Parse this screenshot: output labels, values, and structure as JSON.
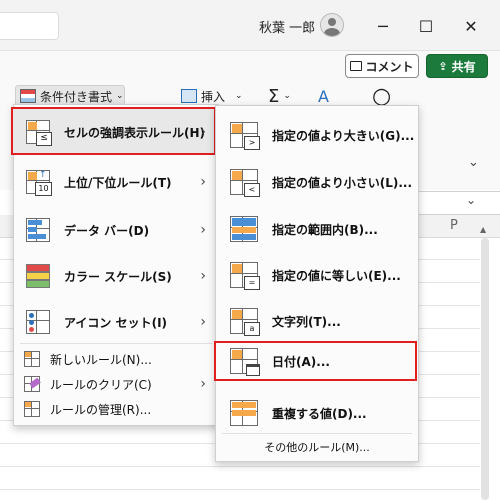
{
  "titlebar": {
    "user_name": "秋葉 一郎",
    "minimize": "─",
    "maximize": "☐",
    "close": "✕"
  },
  "ribbon": {
    "comment_label": "コメント",
    "share_label": "共有",
    "cf_label": "条件付き書式",
    "insert_label": "挿入",
    "sum_symbol": "Σ",
    "sort_symbol": "A",
    "find_symbol": "○"
  },
  "sheet": {
    "col_p": "P"
  },
  "menu": {
    "items": [
      {
        "label": "セルの強調表示ルール(H)",
        "underline": "H",
        "icon": "highlight-cells-rules-icon",
        "highlighted": true
      },
      {
        "label": "上位/下位ルール(T)",
        "underline": "T",
        "icon": "top-bottom-rules-icon"
      },
      {
        "label": "データ バー(D)",
        "underline": "D",
        "icon": "data-bars-icon"
      },
      {
        "label": "カラー スケール(S)",
        "underline": "S",
        "icon": "color-scales-icon"
      },
      {
        "label": "アイコン セット(I)",
        "underline": "I",
        "icon": "icon-sets-icon"
      }
    ],
    "small_items": [
      {
        "label": "新しいルール(N)...",
        "icon": "new-rule-icon"
      },
      {
        "label": "ルールのクリア(C)",
        "icon": "clear-rules-icon"
      },
      {
        "label": "ルールの管理(R)...",
        "icon": "manage-rules-icon"
      }
    ]
  },
  "submenu": {
    "items": [
      {
        "label": "指定の値より大きい(G)...",
        "icon": "greater-than-icon",
        "badge": ">"
      },
      {
        "label": "指定の値より小さい(L)...",
        "icon": "less-than-icon",
        "badge": "<"
      },
      {
        "label": "指定の範囲内(B)...",
        "icon": "between-icon",
        "badge": ""
      },
      {
        "label": "指定の値に等しい(E)...",
        "icon": "equal-to-icon",
        "badge": "="
      },
      {
        "label": "文字列(T)...",
        "icon": "text-contains-icon",
        "badge": "a"
      },
      {
        "label": "日付(A)...",
        "icon": "date-occurring-icon",
        "badge": "",
        "highlighted": true
      },
      {
        "label": "重複する値(D)...",
        "icon": "duplicate-values-icon",
        "badge": ""
      }
    ],
    "more_label": "その他のルール(M)..."
  },
  "colors": {
    "highlight_border": "#e0201e",
    "share_green": "#1c7a3d"
  }
}
